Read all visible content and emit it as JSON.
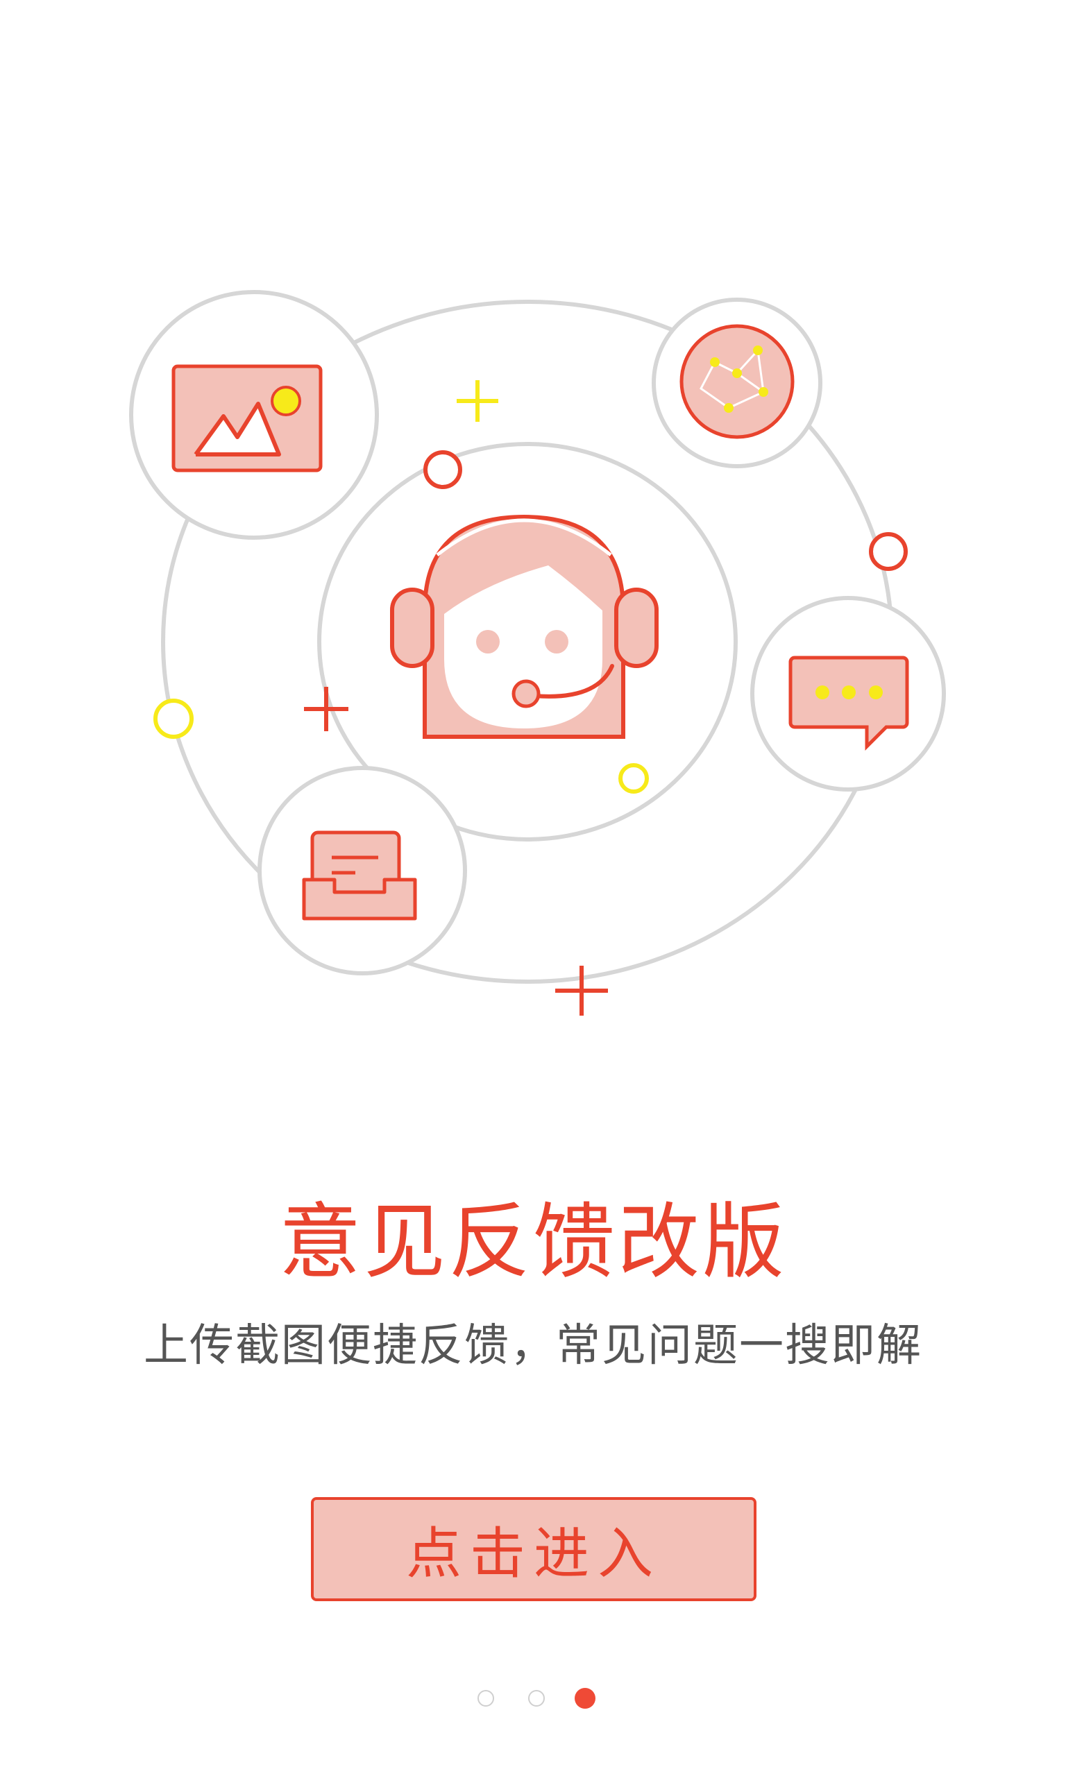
{
  "title": "意见反馈改版",
  "subtitle": "上传截图便捷反馈，常见问题一搜即解",
  "enter_button": "点击进入",
  "pager": {
    "total": 3,
    "active_index": 3
  },
  "colors": {
    "accent": "#e8432d",
    "fill": "#f3c1b8",
    "line": "#d6d6d6",
    "highlight": "#f7ea1a"
  }
}
